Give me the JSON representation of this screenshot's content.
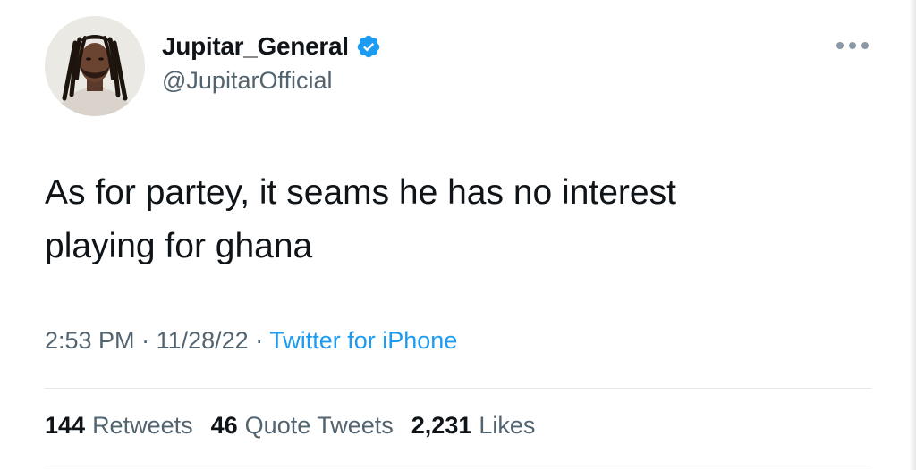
{
  "author": {
    "display_name": "Jupitar_General",
    "handle": "@JupitarOfficial",
    "verified": true,
    "avatar_icon": "profile-photo"
  },
  "tweet": {
    "text": "As for partey, it seams he has no interest\nplaying for ghana",
    "time": "2:53 PM",
    "date": "11/28/22",
    "separator": "·",
    "source": "Twitter for iPhone"
  },
  "stats": {
    "retweets": {
      "count": "144",
      "label": "Retweets"
    },
    "quote_tweets": {
      "count": "46",
      "label": "Quote Tweets"
    },
    "likes": {
      "count": "2,231",
      "label": "Likes"
    }
  },
  "icons": {
    "verified": "verified-badge-icon",
    "more": "more-options-icon"
  },
  "colors": {
    "accent": "#1d9bf0",
    "text": "#0f1419",
    "muted": "#536471"
  }
}
